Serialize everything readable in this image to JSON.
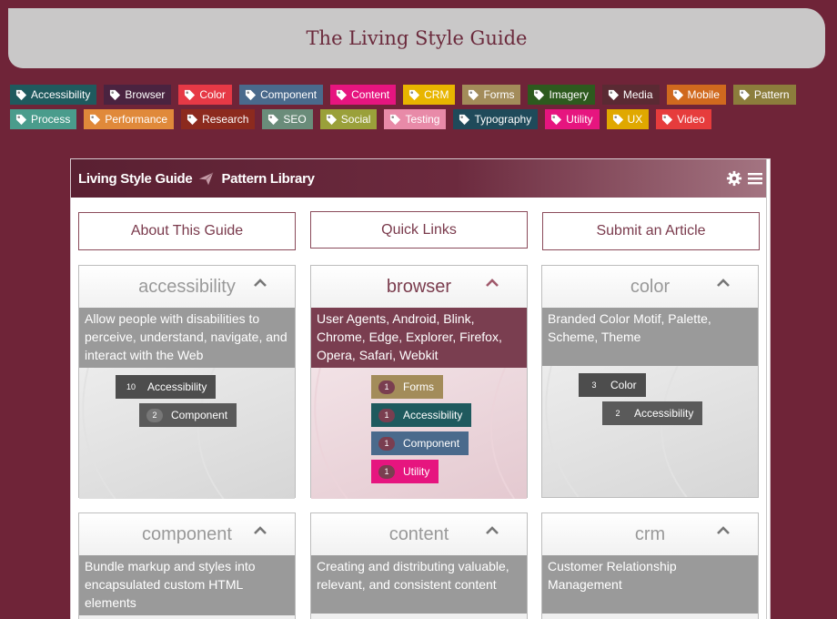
{
  "banner": {
    "title": "The Living Style Guide"
  },
  "tags_row1": [
    {
      "label": "Accessibility",
      "color": "#1f5a5e",
      "icon": "tag-icon"
    },
    {
      "label": "Browser",
      "color": "#4a2340",
      "icon": "tag-icon"
    },
    {
      "label": "Color",
      "color": "#e63946",
      "icon": "tag-icon"
    },
    {
      "label": "Component",
      "color": "#4a6a8c",
      "icon": "tag-icon"
    },
    {
      "label": "Content",
      "color": "#e6157f",
      "icon": "tag-icon"
    },
    {
      "label": "CRM",
      "color": "#e8b500",
      "icon": "tag-icon"
    },
    {
      "label": "Forms",
      "color": "#a38c5a",
      "icon": "tag-icon"
    },
    {
      "label": "Imagery",
      "color": "#2d5a1e",
      "icon": "tag-icon"
    },
    {
      "label": "Media",
      "color": "#5a2a33",
      "icon": "tag-icon"
    },
    {
      "label": "Mobile",
      "color": "#d0691e",
      "icon": "tag-icon"
    },
    {
      "label": "Pattern",
      "color": "#8c7d3c",
      "icon": "tag-icon"
    }
  ],
  "tags_row2": [
    {
      "label": "Process",
      "color": "#4a9c8c",
      "icon": "tag-icon"
    },
    {
      "label": "Performance",
      "color": "#e0893a",
      "icon": "tag-icon"
    },
    {
      "label": "Research",
      "color": "#8c2a1e",
      "icon": "tag-icon"
    },
    {
      "label": "SEO",
      "color": "#6a8c7a",
      "icon": "tag-icon"
    },
    {
      "label": "Social",
      "color": "#9aa03a",
      "icon": "tag-icon"
    },
    {
      "label": "Testing",
      "color": "#e88aa8",
      "icon": "tag-icon"
    },
    {
      "label": "Typography",
      "color": "#1f4a5a",
      "icon": "tag-icon"
    },
    {
      "label": "Utility",
      "color": "#e6157f",
      "icon": "tag-icon"
    },
    {
      "label": "UX",
      "color": "#e0a800",
      "icon": "tag-icon"
    },
    {
      "label": "Video",
      "color": "#e63c3c",
      "icon": "tag-icon"
    }
  ],
  "panel": {
    "brand": "Living Style Guide",
    "section": "Pattern Library",
    "links": {
      "about": "About This Guide",
      "quick": "Quick Links",
      "submit": "Submit an Article"
    }
  },
  "cards": {
    "accessibility": {
      "title": "accessibility",
      "desc": "Allow people with disabilities to perceive, understand, navigate, and interact with the Web",
      "tags": [
        {
          "count": "10",
          "label": "Accessibility",
          "color": "#4d4d4d"
        },
        {
          "count": "2",
          "label": "Component",
          "color": "#5a5a5a"
        }
      ]
    },
    "browser": {
      "title": "browser",
      "desc": "User Agents, Android, Blink, Chrome, Edge, Explorer, Firefox, Opera, Safari, Webkit",
      "tags": [
        {
          "count": "1",
          "label": "Forms",
          "color": "#a38c5a"
        },
        {
          "count": "1",
          "label": "Accessibility",
          "color": "#1f5a5e"
        },
        {
          "count": "1",
          "label": "Component",
          "color": "#4a6a8c"
        },
        {
          "count": "1",
          "label": "Utility",
          "color": "#e6157f"
        }
      ]
    },
    "color": {
      "title": "color",
      "desc": "Branded Color Motif, Palette, Scheme, Theme",
      "tags": [
        {
          "count": "3",
          "label": "Color",
          "color": "#4d4d4d"
        },
        {
          "count": "2",
          "label": "Accessibility",
          "color": "#5a5a5a"
        }
      ]
    },
    "component": {
      "title": "component",
      "desc": "Bundle markup and styles into encapsulated custom HTML elements"
    },
    "content": {
      "title": "content",
      "desc": "Creating and distributing valuable, relevant, and consistent content"
    },
    "crm": {
      "title": "crm",
      "desc": "Customer Relationship Management"
    }
  }
}
